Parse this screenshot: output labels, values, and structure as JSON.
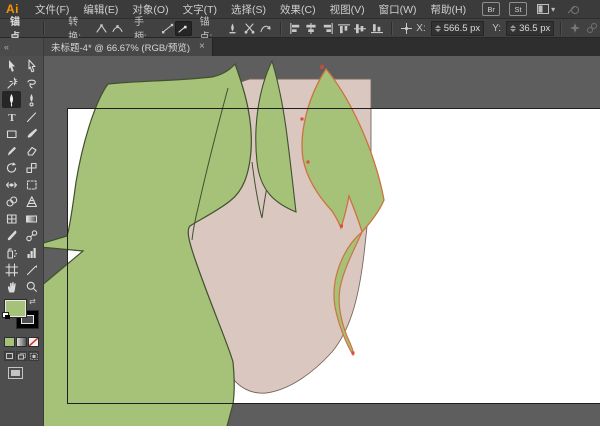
{
  "menu_bar": {
    "logo": "Ai",
    "items": [
      {
        "label": "文件(F)"
      },
      {
        "label": "编辑(E)"
      },
      {
        "label": "对象(O)"
      },
      {
        "label": "文字(T)"
      },
      {
        "label": "选择(S)"
      },
      {
        "label": "效果(C)"
      },
      {
        "label": "视图(V)"
      },
      {
        "label": "窗口(W)"
      },
      {
        "label": "帮助(H)"
      }
    ],
    "bridge_button": "Br",
    "stock_button": "St",
    "workspace_switcher_chevron": "▾"
  },
  "control_bar": {
    "context_label": "锚点",
    "convert_label": "转换:",
    "handles_label": "手柄:",
    "anchors_label": "锚点:",
    "x_label": "X:",
    "x_value": "566.5 px",
    "y_label": "Y:",
    "y_value": "36.5 px"
  },
  "document_tab": {
    "title": "未标题-4* @ 66.67% (RGB/预览)",
    "close_label": "×"
  },
  "toolbar": {
    "collapse_label": "«",
    "selected_tool": "pen",
    "tools": [
      "selection",
      "direct-selection",
      "magic-wand",
      "lasso",
      "pen",
      "curvature",
      "type",
      "line-segment",
      "rectangle",
      "paintbrush",
      "pencil",
      "eraser",
      "rotate",
      "scale",
      "width",
      "free-transform",
      "shape-builder",
      "perspective-grid",
      "mesh",
      "gradient",
      "eyedropper",
      "blend",
      "symbol-sprayer",
      "column-graph",
      "artboard",
      "slice",
      "hand",
      "zoom"
    ]
  },
  "colors": {
    "hair_green": "#a6c278",
    "hair_outline": "#41502f",
    "skin": "#d9c7c0",
    "skin_outline": "#79675c",
    "selection_orange": "#cc7340",
    "anchor_red": "#dd4b38",
    "pasteboard": "#5e5e5e",
    "artboard_white": "#ffffff",
    "artboard_border": "#1f1f1f",
    "fill_swatch": "#a6c278",
    "none_slash_red": "#d23b2f"
  }
}
